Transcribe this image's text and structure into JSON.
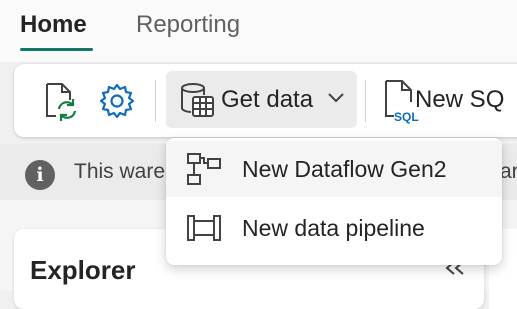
{
  "tabs": [
    {
      "label": "Home",
      "selected": true
    },
    {
      "label": "Reporting",
      "selected": false
    }
  ],
  "toolbar": {
    "refresh_icon": "document-refresh-icon",
    "settings_icon": "gear-icon",
    "get_data_label": "Get data",
    "new_sql_label": "New SQ",
    "new_sql_icon_text": "SQL"
  },
  "infobar": {
    "text": "This ware",
    "tail": "ar"
  },
  "dropdown": {
    "items": [
      {
        "label": "New Dataflow Gen2",
        "icon": "dataflow-icon"
      },
      {
        "label": "New data pipeline",
        "icon": "pipeline-icon"
      }
    ]
  },
  "explorer": {
    "title": "Explorer",
    "collapse_icon": "double-chevron-left-icon"
  },
  "colors": {
    "accent": "#117865",
    "refresh_green": "#107c41",
    "settings_blue": "#0f6cbd",
    "sql_blue": "#0f6cbd"
  }
}
